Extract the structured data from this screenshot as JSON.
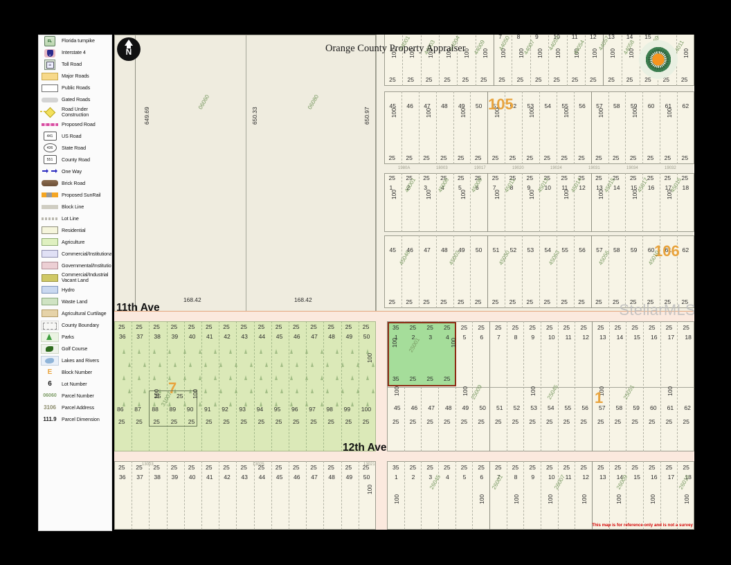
{
  "map": {
    "title": "Orange County Property Appraiser",
    "watermark": "StellarMLS",
    "disclaimer": "This map is for reference only and is not a survey",
    "compass_label": "N",
    "seal_name": "orange-county-seal",
    "streets": [
      {
        "name": "11th Ave"
      },
      {
        "name": "12th Ave"
      }
    ],
    "block_numbers": [
      "105",
      "106",
      "7",
      "1"
    ],
    "selected_parcel": {
      "parcel_number": "25001",
      "lots": [
        "1",
        "2",
        "3",
        "4"
      ],
      "top_dimensions": [
        "35",
        "25",
        "25",
        "25"
      ],
      "bottom_dimensions": [
        "35",
        "25",
        "25",
        "25"
      ],
      "side_dimensions": [
        "100",
        "100"
      ]
    },
    "west_dimensions": [
      "649.69",
      "650.33",
      "650.97"
    ],
    "south_dimensions": [
      "168.42",
      "168.42"
    ],
    "west_parcel_numbers": [
      "06060",
      "06080"
    ],
    "parcel_numbers": [
      "44001",
      "44003",
      "44004",
      "44009",
      "44050",
      "44007",
      "44053",
      "44054",
      "44057",
      "44058",
      "44069",
      "44011",
      "44016",
      "45001",
      "45006",
      "45008",
      "45011",
      "45013",
      "45014",
      "45015",
      "45017",
      "45016",
      "45046",
      "45003",
      "45050",
      "45063",
      "45056",
      "45011",
      "45010",
      "25009",
      "25001",
      "25045",
      "25051",
      "25062",
      "26045",
      "26001",
      "26007",
      "26009",
      "26016",
      "26011"
    ],
    "lot_numbers_row1": [
      "7",
      "8",
      "9",
      "10",
      "11",
      "12",
      "13",
      "14",
      "15"
    ],
    "lot_numbers_row2": [
      "45",
      "46",
      "47",
      "48",
      "49",
      "50",
      "51",
      "52",
      "53",
      "54",
      "55",
      "56",
      "57",
      "58",
      "59",
      "60",
      "61",
      "62"
    ],
    "lot_numbers_row3": [
      "1",
      "2",
      "3",
      "4",
      "5",
      "6",
      "7",
      "8",
      "9",
      "10",
      "11",
      "12",
      "13",
      "14",
      "15",
      "16",
      "17",
      "18"
    ],
    "lot_numbers_row4": [
      "45",
      "46",
      "47",
      "48",
      "49",
      "50",
      "51",
      "52",
      "53",
      "54",
      "55",
      "56",
      "57",
      "58",
      "59",
      "60",
      "61",
      "62"
    ],
    "lot_numbers_row5": [
      "1",
      "2",
      "3",
      "4",
      "5",
      "6",
      "7",
      "8",
      "9",
      "10",
      "11",
      "12",
      "13",
      "14",
      "15",
      "16",
      "17",
      "18"
    ],
    "lot_numbers_row6": [
      "45",
      "46",
      "47",
      "48",
      "49",
      "50",
      "51",
      "52",
      "53",
      "54",
      "55",
      "56",
      "57",
      "58",
      "59",
      "60",
      "61",
      "62"
    ],
    "lot_numbers_agri_top": [
      "36",
      "37",
      "38",
      "39",
      "40",
      "41",
      "42",
      "43",
      "44",
      "45",
      "46",
      "47",
      "48",
      "49",
      "50"
    ],
    "lot_numbers_agri_bottom": [
      "86",
      "87",
      "88",
      "89",
      "90",
      "91",
      "92",
      "93",
      "94",
      "95",
      "96",
      "97",
      "98",
      "99",
      "100"
    ],
    "lot_numbers_bottom": [
      "36",
      "37",
      "38",
      "39",
      "40",
      "41",
      "42",
      "43",
      "44",
      "45",
      "46",
      "47",
      "48",
      "49",
      "50"
    ],
    "dim_25": "25",
    "dim_100": "100",
    "dim_35": "35",
    "dim_31007": "31007"
  },
  "legend": {
    "items": [
      {
        "label": "Florida turnpike",
        "icon": "turnpike-shield-icon",
        "symbol": "shield",
        "text": "FL"
      },
      {
        "label": "Interstate 4",
        "icon": "interstate-shield-icon",
        "symbol": "i4",
        "text": "4"
      },
      {
        "label": "Toll Road",
        "icon": "toll-road-icon",
        "symbol": "toll",
        "text": "48"
      },
      {
        "label": "Major Roads",
        "icon": "major-road-swatch",
        "symbol": "swatch",
        "color": "#f7d98a",
        "border": "#c9a94e"
      },
      {
        "label": "Public Roads",
        "icon": "public-road-swatch",
        "symbol": "swatch",
        "color": "#ffffff",
        "border": "#6e6e6e"
      },
      {
        "label": "Gated Roads",
        "icon": "gated-road-swatch",
        "symbol": "gated"
      },
      {
        "label": "Road Under Construction",
        "icon": "road-construction-icon",
        "symbol": "ruc"
      },
      {
        "label": "Proposed Road",
        "icon": "proposed-road-icon",
        "symbol": "propline"
      },
      {
        "label": "US Road",
        "icon": "us-road-shield-icon",
        "symbol": "rdshield",
        "text": "441"
      },
      {
        "label": "State Road",
        "icon": "state-road-shield-icon",
        "symbol": "rdshield-oval",
        "text": "436"
      },
      {
        "label": "County Road",
        "icon": "county-road-shield-icon",
        "symbol": "rdshield",
        "text": "551"
      },
      {
        "label": "One Way",
        "icon": "one-way-arrow-icon",
        "symbol": "oneway"
      },
      {
        "label": "Brick Road",
        "icon": "brick-road-icon",
        "symbol": "brick"
      },
      {
        "label": "Proposed SunRail",
        "icon": "sunrail-icon",
        "symbol": "sunrail"
      },
      {
        "label": "Block Line",
        "icon": "block-line-icon",
        "symbol": "blockline"
      },
      {
        "label": "Lot Line",
        "icon": "lot-line-icon",
        "symbol": "lotline"
      },
      {
        "label": "Residential",
        "icon": "residential-swatch",
        "symbol": "swatch",
        "color": "#f5f5dc",
        "border": "#8f8f7a"
      },
      {
        "label": "Agriculture",
        "icon": "agriculture-swatch",
        "symbol": "swatch",
        "color": "#dff0c0",
        "border": "#8fae74"
      },
      {
        "label": "Commercial/Institutional",
        "icon": "commercial-institutional-swatch",
        "symbol": "swatch",
        "color": "#e0e0f5",
        "border": "#8f8fb0"
      },
      {
        "label": "Governmental/Institutional/Misc",
        "icon": "governmental-swatch",
        "symbol": "swatch",
        "color": "#eccfd4",
        "border": "#b08f96"
      },
      {
        "label": "Commercial/Industrial Vacant Land",
        "icon": "commercial-vacant-swatch",
        "symbol": "swatch",
        "color": "#cfc865",
        "border": "#9a9440"
      },
      {
        "label": "Hydro",
        "icon": "hydro-swatch",
        "symbol": "swatch",
        "color": "#c9d8f0",
        "border": "#7f95bb"
      },
      {
        "label": "Waste Land",
        "icon": "waste-land-swatch",
        "symbol": "swatch",
        "color": "#cfe3c3",
        "border": "#8aa87e"
      },
      {
        "label": "Agricultural Curtilage",
        "icon": "agricultural-curtilage-swatch",
        "symbol": "swatch",
        "color": "#e6d3a8",
        "border": "#b39c66"
      },
      {
        "label": "County Boundary",
        "icon": "county-boundary-icon",
        "symbol": "cbico"
      },
      {
        "label": "Parks",
        "icon": "parks-icon",
        "symbol": "parkico"
      },
      {
        "label": "Golf Course",
        "icon": "golf-course-icon",
        "symbol": "golfico"
      },
      {
        "label": "Lakes and Rivers",
        "icon": "lakes-rivers-icon",
        "symbol": "hydroico"
      },
      {
        "label": "Block Number",
        "icon": "block-number-icon",
        "symbol": "txt",
        "text": "E",
        "color": "#e8a33d"
      },
      {
        "label": "Lot Number",
        "icon": "lot-number-icon",
        "symbol": "txt",
        "text": "6",
        "color": "#1a1a1a"
      },
      {
        "label": "Parcel Number",
        "icon": "parcel-number-icon",
        "symbol": "txt",
        "text": "06060",
        "color": "#7a9a63",
        "size": "7px"
      },
      {
        "label": "Parcel Address",
        "icon": "parcel-address-icon",
        "symbol": "txt",
        "text": "3106",
        "color": "#8a8a6a",
        "size": "8px"
      },
      {
        "label": "Parcel Dimension",
        "icon": "parcel-dimension-icon",
        "symbol": "txt",
        "text": "111.9",
        "color": "#1a1a1a",
        "size": "8px"
      }
    ]
  }
}
